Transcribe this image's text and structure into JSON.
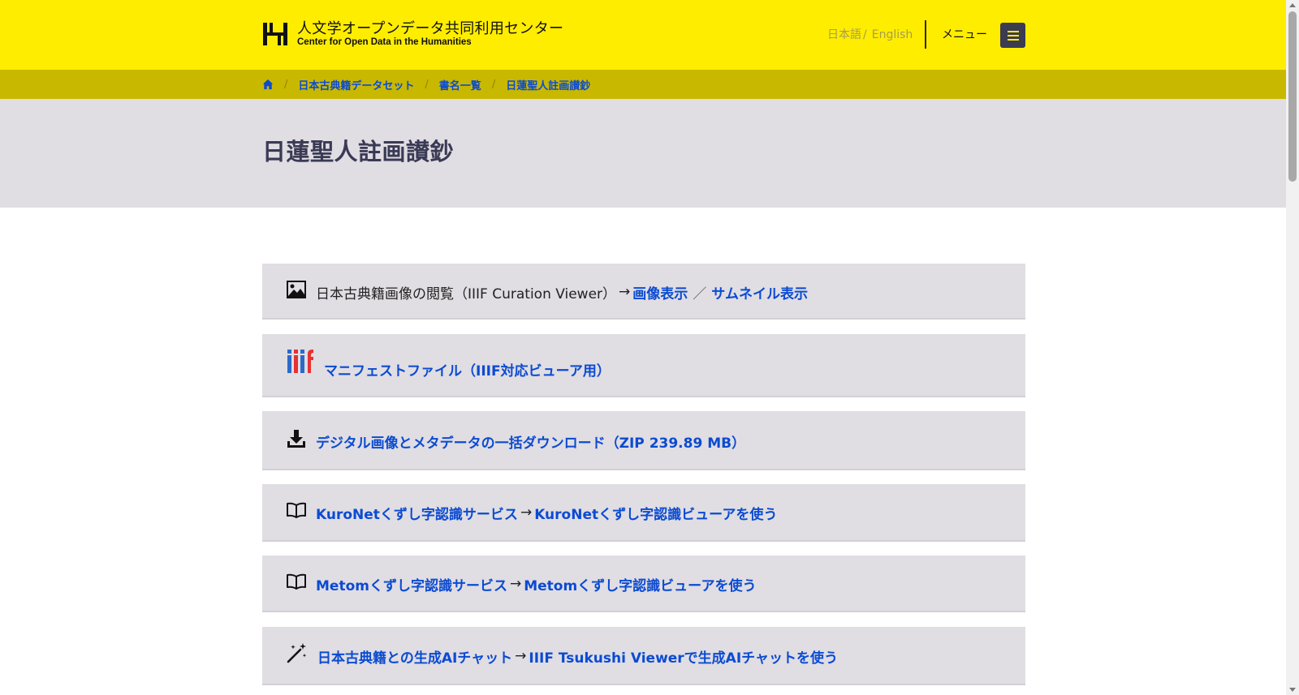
{
  "header": {
    "logo_ja": "人文学オープンデータ共同利用センター",
    "logo_en": "Center for Open Data in the Humanities",
    "lang_ja": "日本語",
    "lang_sep": "/",
    "lang_en": "English",
    "menu_label": "メニュー",
    "menu_icon": "hamburger-icon",
    "background": "#ffed00"
  },
  "breadcrumb": {
    "home_icon": "home-icon",
    "separator": "/",
    "items": [
      "日本古典籍データセット",
      "書名一覧",
      "日蓮聖人註画讃鈔"
    ],
    "background": "#c9b800"
  },
  "page": {
    "title": "日蓮聖人註画讃鈔"
  },
  "panels": [
    {
      "icon": "image-icon",
      "text": "日本古典籍画像の閲覧（IIIF Curation Viewer）",
      "arrow": "→",
      "link1": "画像表示",
      "slash": "／",
      "link2": "サムネイル表示"
    },
    {
      "icon": "iiif-logo-icon",
      "link1": "マニフェストファイル（IIIF対応ビューア用）"
    },
    {
      "icon": "download-icon",
      "link1": "デジタル画像とメタデータの一括ダウンロード（ZIP 239.89 MB）"
    },
    {
      "icon": "book-icon",
      "link1": "KuroNetくずし字認識サービス",
      "arrow": "→",
      "link2": "KuroNetくずし字認識ビューアを使う"
    },
    {
      "icon": "book-icon",
      "link1": "Metomくずし字認識サービス",
      "arrow": "→",
      "link2": "Metomくずし字認識ビューアを使う"
    },
    {
      "icon": "magic-wand-icon",
      "link1": "日本古典籍との生成AIチャット",
      "arrow": "→",
      "link2": "IIIF Tsukushi Viewerで生成AIチャットを使う"
    }
  ],
  "colors": {
    "link": "#0b4bd1",
    "panel_bg": "#e0dde3",
    "title_color": "#3a3a55"
  }
}
